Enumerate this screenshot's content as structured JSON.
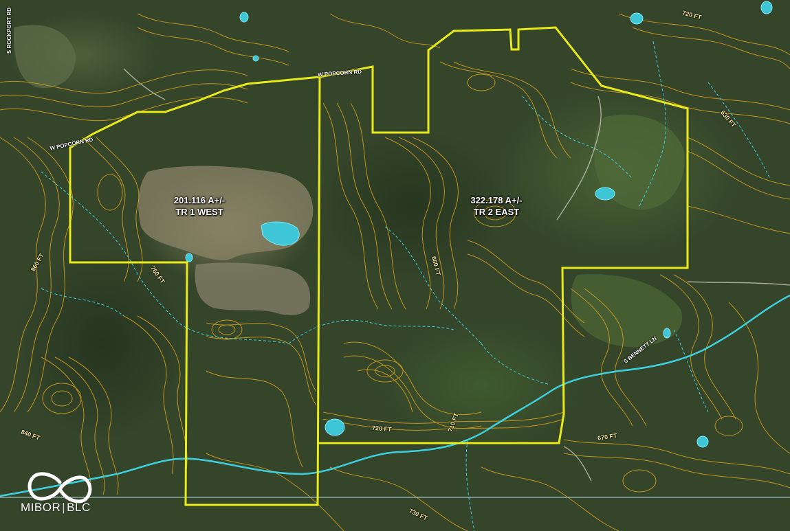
{
  "tracts": [
    {
      "acreage": "201.116 A+/-",
      "name": "TR 1 WEST"
    },
    {
      "acreage": "322.178 A+/-",
      "name": "TR 2 EAST"
    }
  ],
  "roads": [
    {
      "label": "S ROCKPORT RD"
    },
    {
      "label": "W POPCORN RD"
    },
    {
      "label": "W POPCORN RD"
    },
    {
      "label": "S BENNETT LN"
    }
  ],
  "elevations": [
    {
      "label": "720 FT"
    },
    {
      "label": "630 FT"
    },
    {
      "label": "680 FT"
    },
    {
      "label": "760 FT"
    },
    {
      "label": "860 FT"
    },
    {
      "label": "840 FT"
    },
    {
      "label": "720 FT"
    },
    {
      "label": "710 FT"
    },
    {
      "label": "670 FT"
    },
    {
      "label": "730 FT"
    }
  ],
  "logo": {
    "brand_left": "MIBOR",
    "brand_right": "BLC"
  },
  "colors": {
    "boundary": "#e8ea1c",
    "contour": "#d9a21f",
    "stream": "#3fd0e0",
    "pond": "#3fc6d6"
  }
}
